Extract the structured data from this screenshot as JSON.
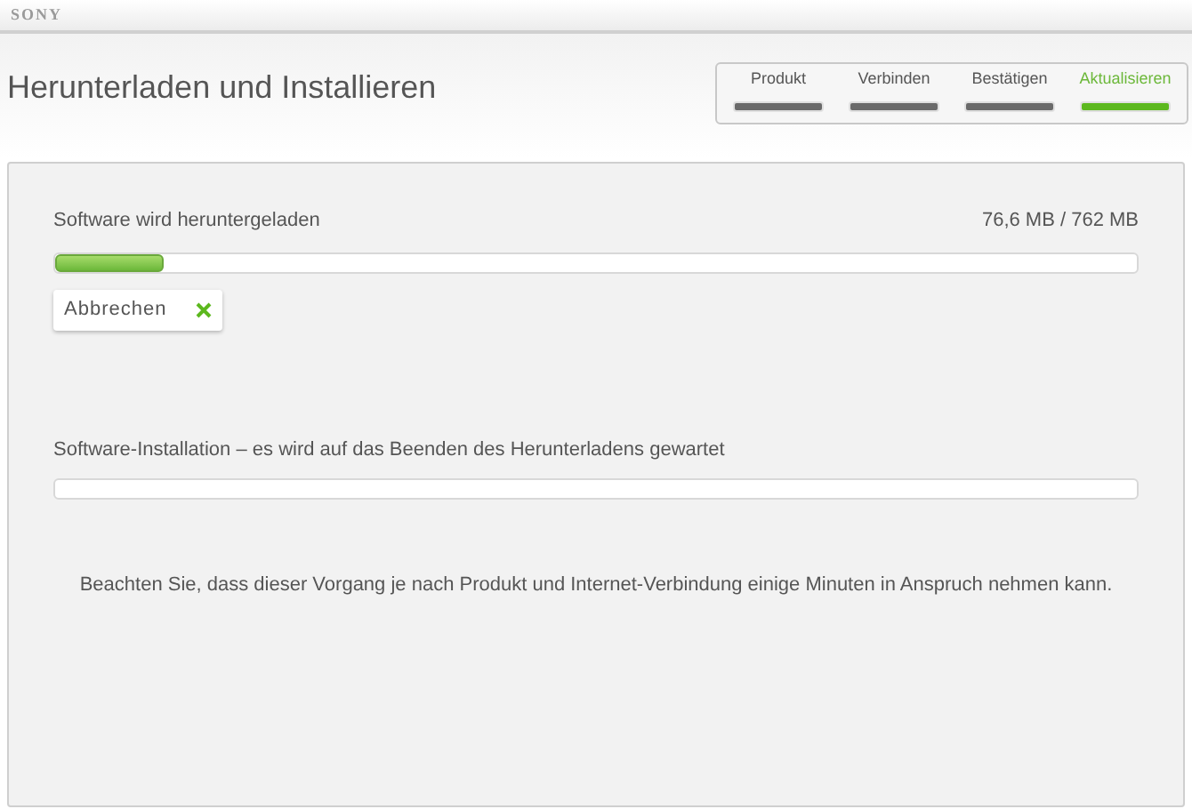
{
  "header": {
    "brand": "SONY"
  },
  "title": "Herunterladen und Installieren",
  "steps": [
    {
      "label": "Produkt",
      "selected": false
    },
    {
      "label": "Verbinden",
      "selected": false
    },
    {
      "label": "Bestätigen",
      "selected": false
    },
    {
      "label": "Aktualisieren",
      "selected": true
    }
  ],
  "download": {
    "label": "Software wird heruntergeladen",
    "reading": "76,6 MB / 762 MB",
    "level": 0.1,
    "cancel_button": "Abbrechen"
  },
  "install": {
    "label": "Software-Installation – es wird auf das Beenden des Herunterladens gewartet",
    "level": 0
  },
  "note": "Beachten Sie, dass dieser Vorgang je nach Produkt und Internet-Verbindung einige Minuten in Anspruch nehmen kann."
}
